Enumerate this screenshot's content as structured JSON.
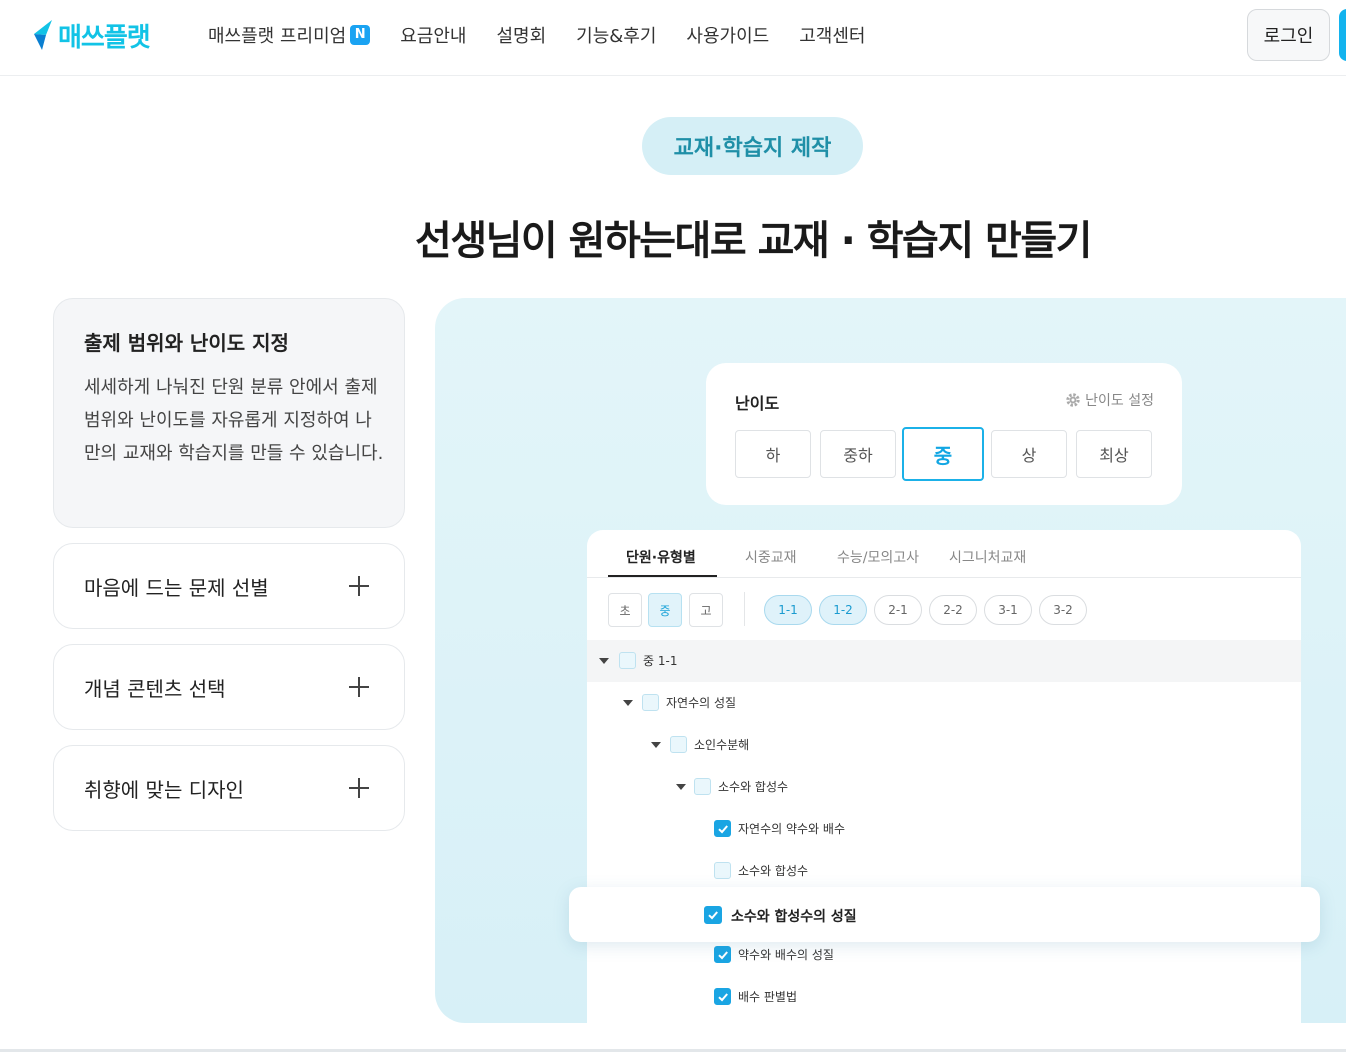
{
  "header": {
    "logo_text": "매쓰플랫",
    "nav": [
      {
        "label": "매쓰플랫 프리미엄",
        "badge": "N"
      },
      {
        "label": "요금안내"
      },
      {
        "label": "설명회"
      },
      {
        "label": "기능&후기"
      },
      {
        "label": "사용가이드"
      },
      {
        "label": "고객센터"
      }
    ],
    "login_label": "로그인"
  },
  "section": {
    "pill": "교재·학습지 제작",
    "headline": "선생님이 원하는대로 교재 · 학습지 만들기"
  },
  "features": [
    {
      "title": "출제 범위와 난이도 지정",
      "desc": "세세하게 나눠진 단원 분류 안에서 출제 범위와 난이도를 자유롭게 지정하여 나만의 교재와 학습지를 만들 수 있습니다.",
      "expanded": true
    },
    {
      "title": "마음에 드는 문제 선별",
      "expanded": false
    },
    {
      "title": "개념 콘텐츠 선택",
      "expanded": false
    },
    {
      "title": "취향에 맞는 디자인",
      "expanded": false
    }
  ],
  "difficulty": {
    "title": "난이도",
    "setting_label": "난이도 설정",
    "levels": [
      "하",
      "중하",
      "중",
      "상",
      "최상"
    ],
    "selected": "중"
  },
  "tree_panel": {
    "tabs": [
      "단원·유형별",
      "시중교재",
      "수능/모의고사",
      "시그니처교재"
    ],
    "active_tab": "단원·유형별",
    "school_levels": [
      "초",
      "중",
      "고"
    ],
    "active_school_level": "중",
    "grades": [
      "1-1",
      "1-2",
      "2-1",
      "2-2",
      "3-1",
      "3-2"
    ],
    "active_grades": [
      "1-1",
      "1-2"
    ],
    "rows": [
      {
        "label": "중 1-1",
        "checked": false
      },
      {
        "label": "자연수의 성질",
        "checked": false
      },
      {
        "label": "소인수분해",
        "checked": false
      },
      {
        "label": "소수와 합성수",
        "checked": false
      },
      {
        "label": "자연수의 약수와 배수",
        "checked": true
      },
      {
        "label": "소수와 합성수",
        "checked": false
      },
      {
        "label": "소수와 합성수의 성질",
        "checked": true,
        "highlighted": true
      },
      {
        "label": "약수와 배수의 성질",
        "checked": true
      },
      {
        "label": "배수 판별법",
        "checked": true
      }
    ]
  },
  "colors": {
    "accent": "#13b3ee",
    "pill_bg": "#d5eff6",
    "demo_bg": "#dff3f8"
  }
}
